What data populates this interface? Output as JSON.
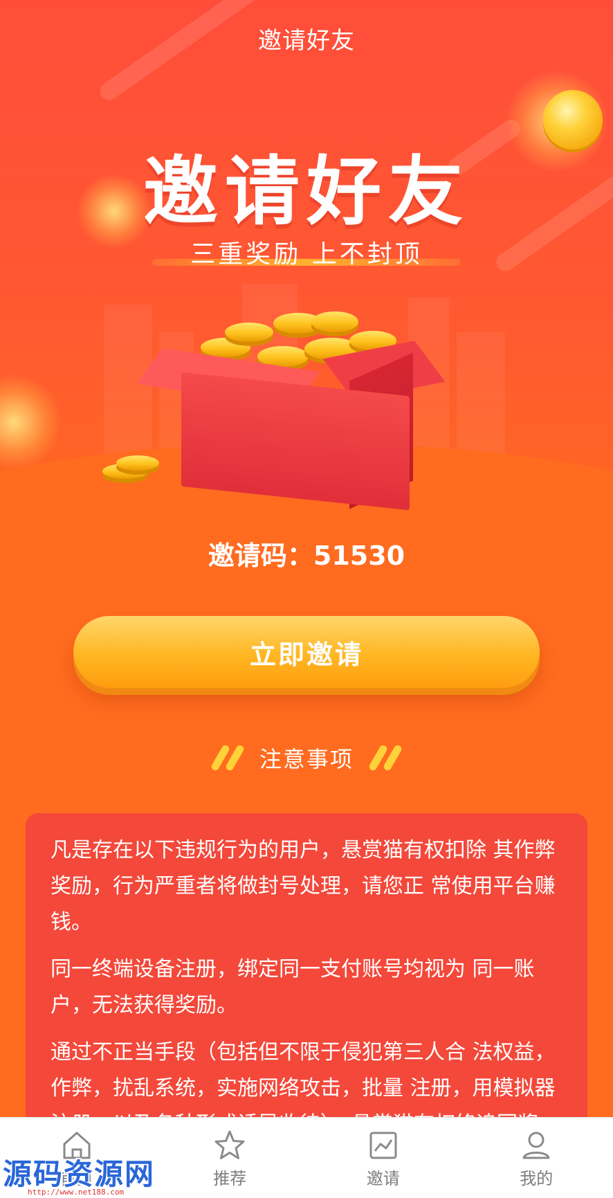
{
  "header": {
    "title": "邀请好友"
  },
  "hero": {
    "title": "邀请好友",
    "subtitle": "三重奖励 上不封顶"
  },
  "invite": {
    "code_text": "邀请码：51530",
    "button_label": "立即邀请"
  },
  "notice": {
    "title": "注意事项",
    "paragraphs": [
      "凡是存在以下违规行为的用户，悬赏猫有权扣除 其作弊奖励，行为严重者将做封号处理，请您正 常使用平台赚钱。",
      "同一终端设备注册，绑定同一支付账号均视为 同一账户，无法获得奖励。",
      "通过不正当手段（包括但不限于侵犯第三人合 法权益，作弊，扰乱系统，实施网络攻击，批量 注册，用模拟器注册，以及各种形式诱导收徒），悬赏猫有权终追回奖"
    ]
  },
  "nav": {
    "items": [
      {
        "label": "首页",
        "icon": "home-icon"
      },
      {
        "label": "推荐",
        "icon": "star-icon"
      },
      {
        "label": "邀请",
        "icon": "chart-icon"
      },
      {
        "label": "我的",
        "icon": "user-icon"
      }
    ]
  },
  "watermark": {
    "text": "源码资源网",
    "url": "http://www.net188.com"
  },
  "colors": {
    "background": "#ff6b1f",
    "card": "#f3483a",
    "button": "#ffb622",
    "nav_label": "#7d7d7d"
  }
}
